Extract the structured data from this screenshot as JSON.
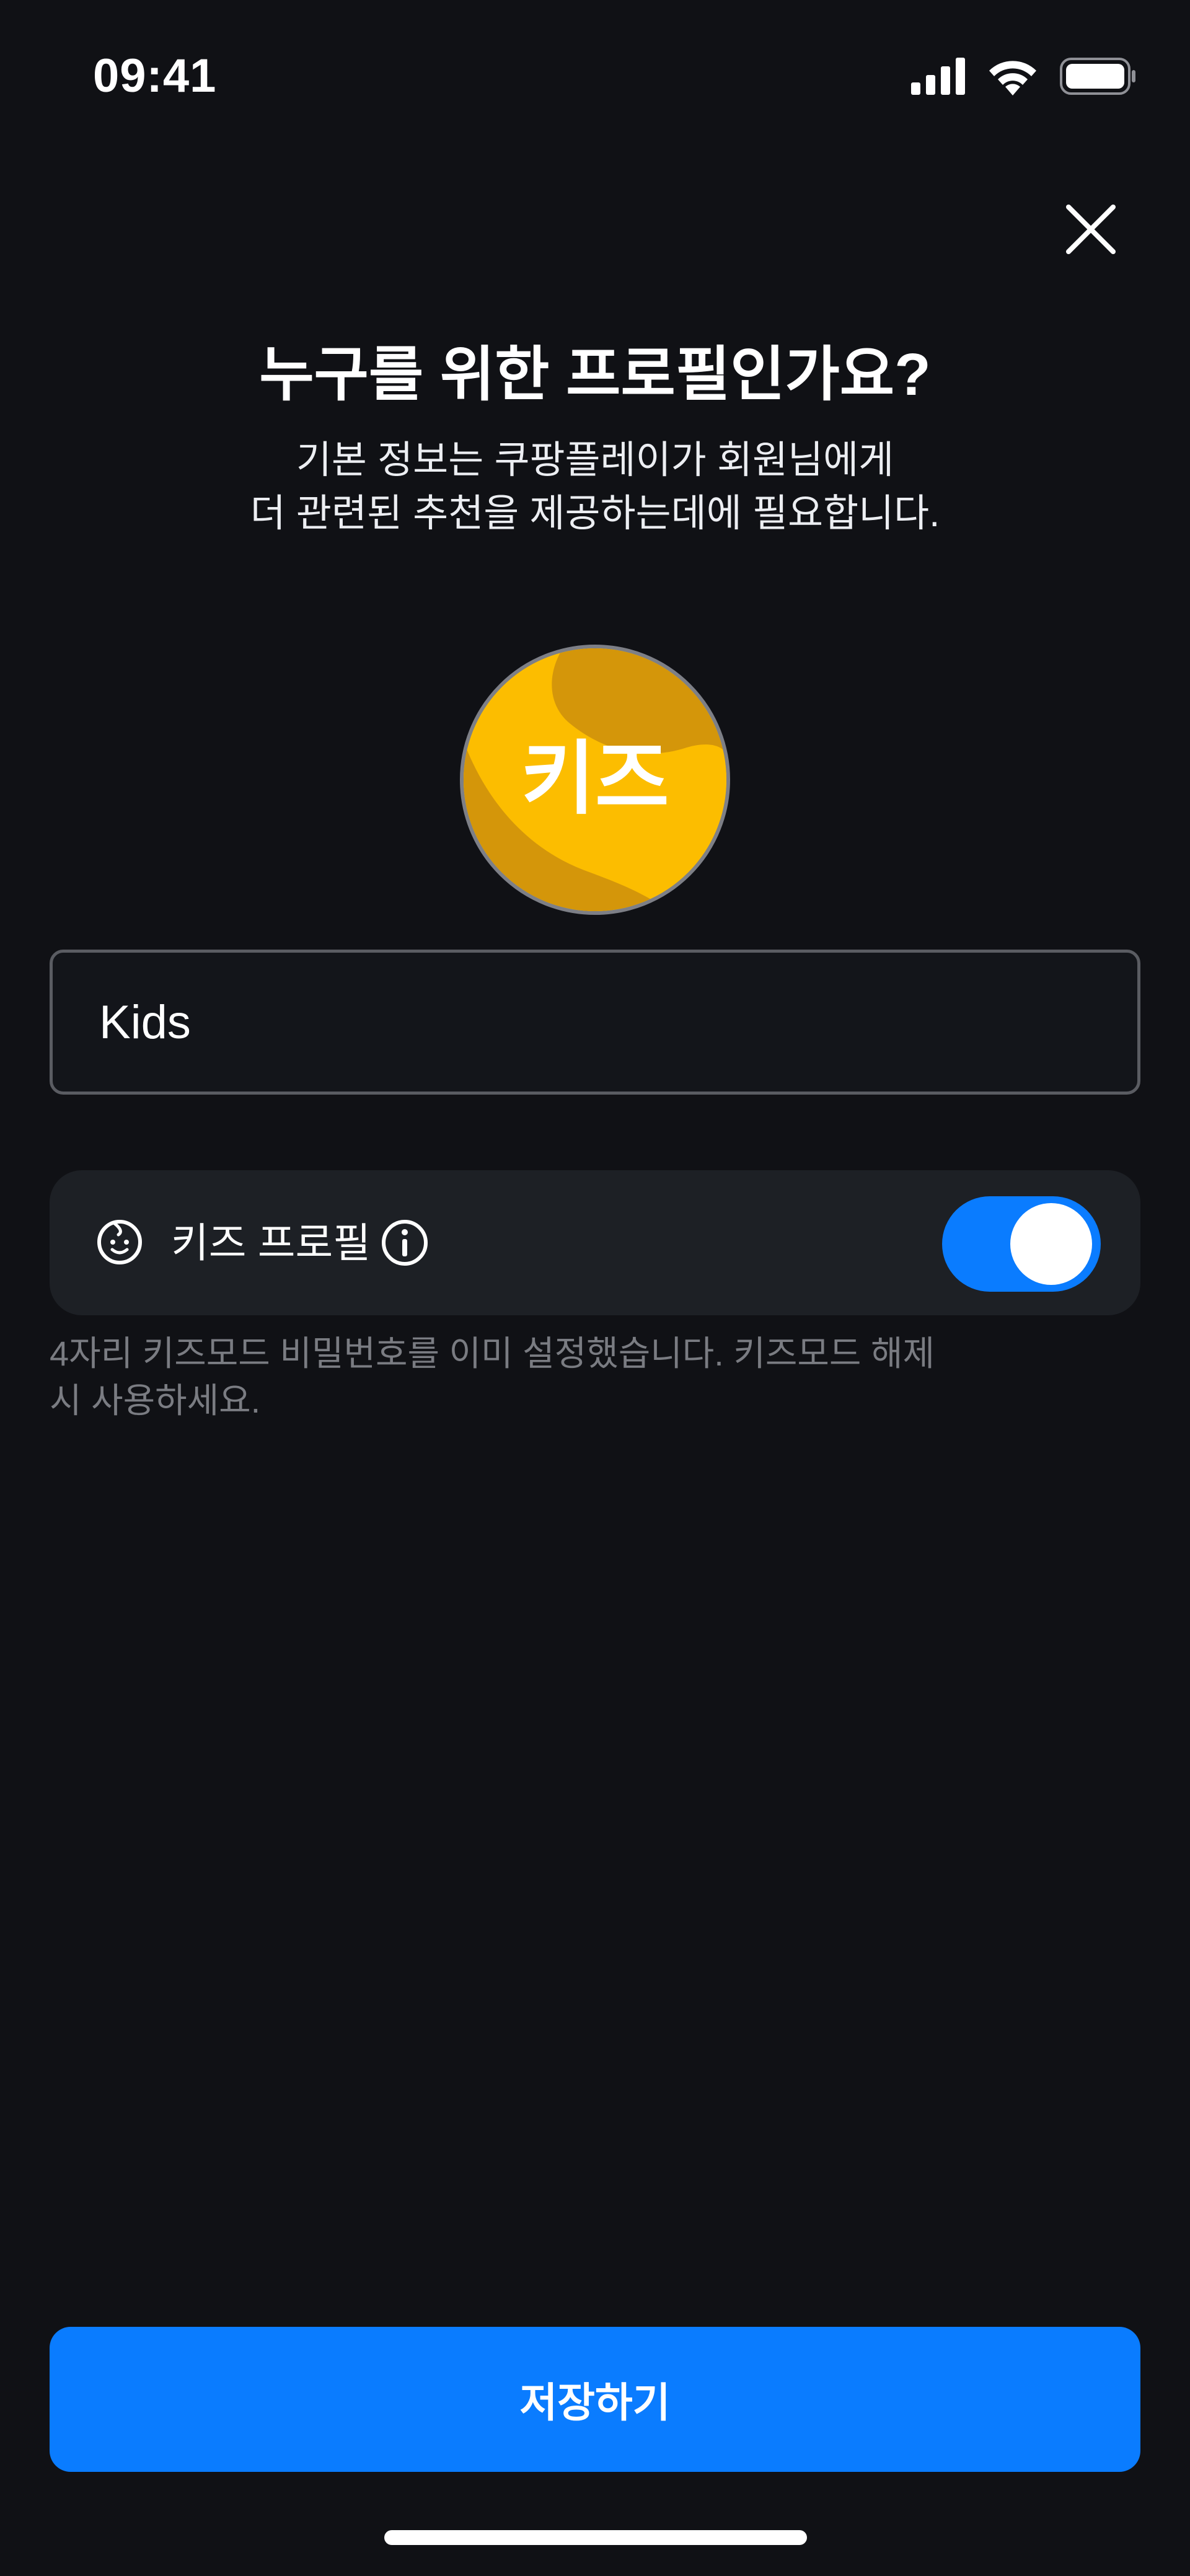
{
  "status_bar": {
    "time": "09:41"
  },
  "header": {
    "title": "누구를 위한 프로필인가요?",
    "subtitle_line1": "기본 정보는 쿠팡플레이가 회원님에게",
    "subtitle_line2": "더 관련된 추천을 제공하는데에 필요합니다."
  },
  "avatar": {
    "label": "키즈",
    "background_color": "#fcbd00",
    "accent_color": "#d4960a"
  },
  "name_field": {
    "value": "Kids"
  },
  "kids_profile": {
    "label": "키즈 프로필",
    "enabled": true,
    "helper_line1": "4자리 키즈모드 비밀번호를 이미 설정했습니다. 키즈모드 해제",
    "helper_line2": "시 사용하세요."
  },
  "footer": {
    "save_label": "저장하기"
  },
  "colors": {
    "background": "#101115",
    "accent": "#0a7cff",
    "card": "#1d2025",
    "muted_text": "#7a7c82"
  }
}
